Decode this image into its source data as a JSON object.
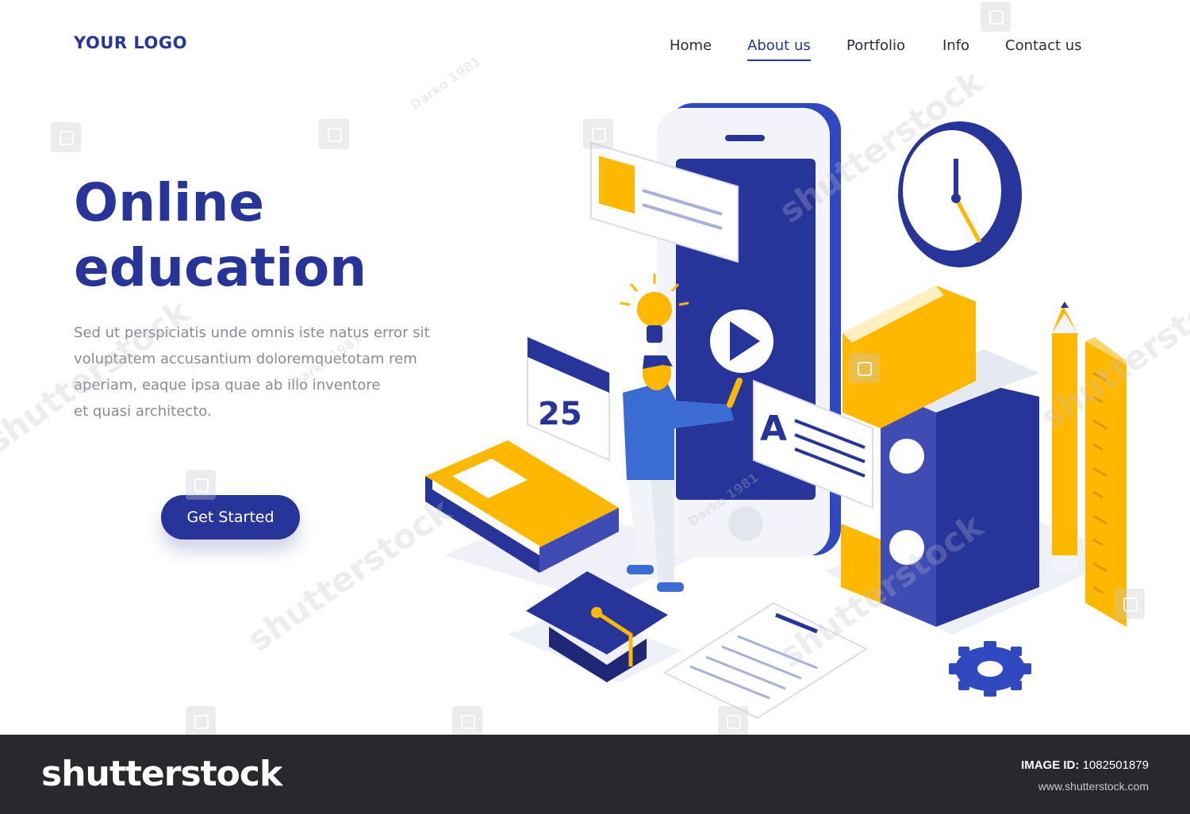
{
  "header": {
    "logo": "YOUR LOGO",
    "nav": [
      {
        "label": "Home",
        "active": false
      },
      {
        "label": "About us",
        "active": true
      },
      {
        "label": "Portfolio",
        "active": false
      },
      {
        "label": "Info",
        "active": false
      },
      {
        "label": "Contact us",
        "active": false
      }
    ]
  },
  "hero": {
    "title_line1": "Online",
    "title_line2": "education",
    "body_lines": [
      "Sed ut perspiciatis unde omnis iste natus error sit",
      "voluptatem accusantium doloremquetotam rem",
      "aperiam, eaque ipsa quae ab illo inventore",
      "et quasi architecto."
    ],
    "cta_label": "Get Started"
  },
  "illustration": {
    "calendar_day": "25",
    "card_letter": "A",
    "icons": [
      "smartphone-icon",
      "play-icon",
      "lightbulb-icon",
      "clock-icon",
      "calendar-icon",
      "book-icon",
      "graduation-cap-icon",
      "document-icon",
      "gear-icon",
      "pencil-icon",
      "ruler-icon",
      "person-icon"
    ]
  },
  "watermark": {
    "brand": "shutterstock",
    "author": "Darko 1981"
  },
  "footer": {
    "brand": "shutterstock",
    "image_id_label": "IMAGE ID:",
    "image_id": "1082501879",
    "url": "www.shutterstock.com"
  },
  "colors": {
    "primary": "#27349a",
    "accent": "#ffb800",
    "light": "#eceef5",
    "footer": "#28292e"
  }
}
